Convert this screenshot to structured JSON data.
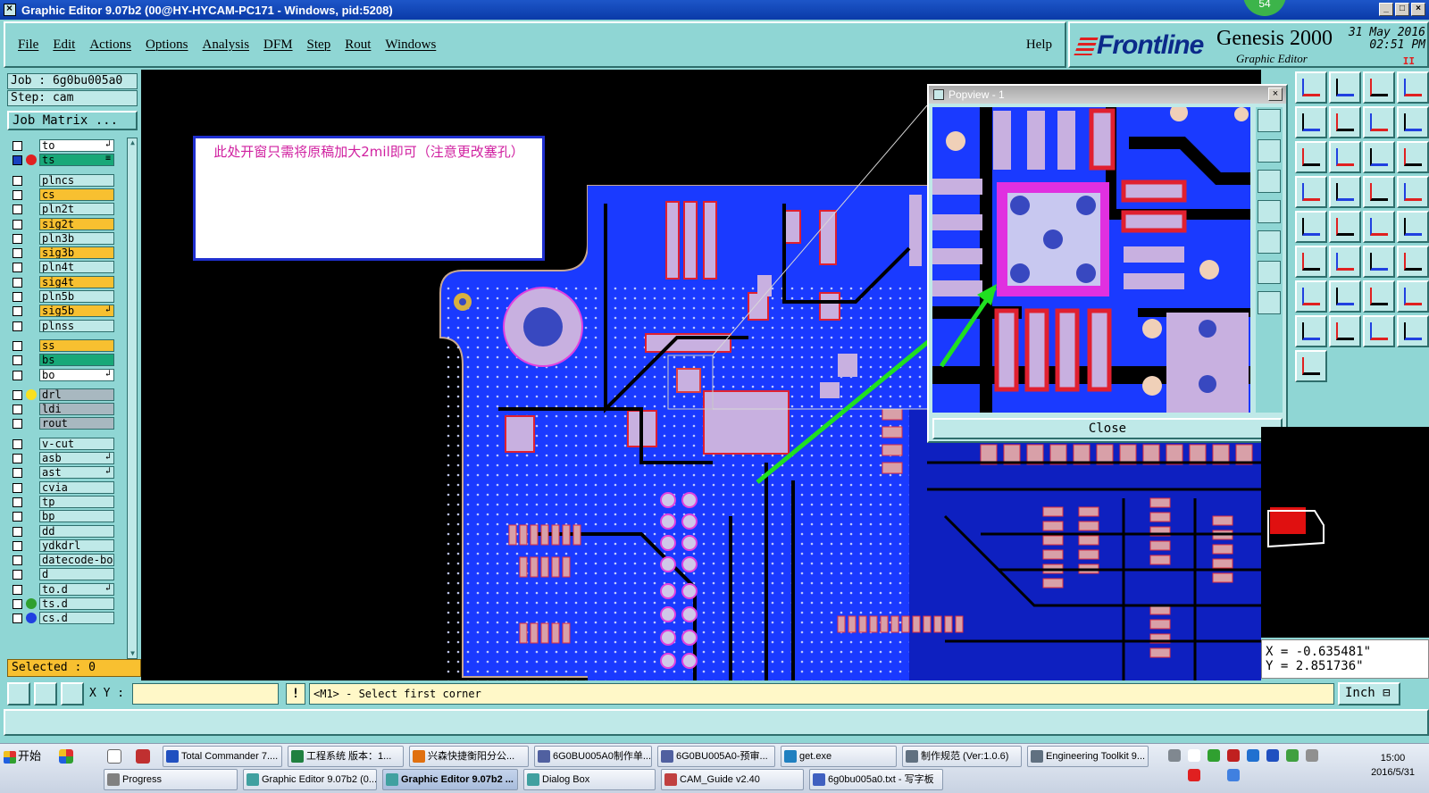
{
  "window": {
    "title": "Graphic Editor 9.07b2 (00@HY-HYCAM-PC171 - Windows, pid:5208)",
    "badge": "54",
    "controls": [
      "_",
      "□",
      "×"
    ]
  },
  "menu": {
    "items": [
      "File",
      "Edit",
      "Actions",
      "Options",
      "Analysis",
      "DFM",
      "Step",
      "Rout",
      "Windows"
    ],
    "help": "Help"
  },
  "brand": {
    "logo": "Frontline",
    "product": "Genesis 2000",
    "subtitle": "Graphic Editor",
    "date": "31 May 2016",
    "time": "02:51 PM",
    "pause": "II"
  },
  "job": {
    "job_line": "Job : 6g0bu005a0",
    "step_line": "Step: cam",
    "matrix_button": "Job Matrix ..."
  },
  "layers": [
    {
      "name": "to",
      "color": "#ffffff",
      "dot": "",
      "flag": "↲"
    },
    {
      "name": "ts",
      "color": "#18a878",
      "dot": "#e02020",
      "flag": "≡",
      "selected": true
    },
    {
      "name": "plncs",
      "color": "#bfe9e8",
      "dot": "",
      "flag": ""
    },
    {
      "name": "cs",
      "color": "#f8c030",
      "dot": "",
      "flag": ""
    },
    {
      "name": "pln2t",
      "color": "#bfe9e8",
      "dot": "",
      "flag": ""
    },
    {
      "name": "sig2t",
      "color": "#f8c030",
      "dot": "",
      "flag": ""
    },
    {
      "name": "pln3b",
      "color": "#bfe9e8",
      "dot": "",
      "flag": ""
    },
    {
      "name": "sig3b",
      "color": "#f8c030",
      "dot": "",
      "flag": ""
    },
    {
      "name": "pln4t",
      "color": "#bfe9e8",
      "dot": "",
      "flag": ""
    },
    {
      "name": "sig4t",
      "color": "#f8c030",
      "dot": "",
      "flag": ""
    },
    {
      "name": "pln5b",
      "color": "#bfe9e8",
      "dot": "",
      "flag": ""
    },
    {
      "name": "sig5b",
      "color": "#f8c030",
      "dot": "",
      "flag": "↲"
    },
    {
      "name": "plnss",
      "color": "#bfe9e8",
      "dot": "",
      "flag": ""
    },
    {
      "name": "ss",
      "color": "#f8c030",
      "dot": "",
      "flag": ""
    },
    {
      "name": "bs",
      "color": "#18a878",
      "dot": "",
      "flag": ""
    },
    {
      "name": "bo",
      "color": "#ffffff",
      "dot": "",
      "flag": "↲"
    },
    {
      "name": "drl",
      "color": "#a8b8c0",
      "dot": "#f8e020",
      "flag": ""
    },
    {
      "name": "ldi",
      "color": "#a8b8c0",
      "dot": "",
      "flag": ""
    },
    {
      "name": "rout",
      "color": "#a8b8c0",
      "dot": "",
      "flag": ""
    },
    {
      "name": "v-cut",
      "color": "#bfe9e8",
      "dot": "",
      "flag": ""
    },
    {
      "name": "asb",
      "color": "#bfe9e8",
      "dot": "",
      "flag": "↲"
    },
    {
      "name": "ast",
      "color": "#bfe9e8",
      "dot": "",
      "flag": "↲"
    },
    {
      "name": "cvia",
      "color": "#bfe9e8",
      "dot": "",
      "flag": ""
    },
    {
      "name": "tp",
      "color": "#bfe9e8",
      "dot": "",
      "flag": ""
    },
    {
      "name": "bp",
      "color": "#bfe9e8",
      "dot": "",
      "flag": ""
    },
    {
      "name": "dd",
      "color": "#bfe9e8",
      "dot": "",
      "flag": ""
    },
    {
      "name": "ydkdrl",
      "color": "#bfe9e8",
      "dot": "",
      "flag": ""
    },
    {
      "name": "datecode-bo",
      "color": "#bfe9e8",
      "dot": "",
      "flag": ""
    },
    {
      "name": "d",
      "color": "#bfe9e8",
      "dot": "",
      "flag": ""
    },
    {
      "name": "to.d",
      "color": "#bfe9e8",
      "dot": "",
      "flag": "↲"
    },
    {
      "name": "ts.d",
      "color": "#bfe9e8",
      "dot": "#30a030",
      "flag": ""
    },
    {
      "name": "cs.d",
      "color": "#bfe9e8",
      "dot": "#2040e0",
      "flag": ""
    }
  ],
  "selected_label": "Selected : 0",
  "annotation": {
    "text": "此处开窗只需将原稿加大2mil即可（注意更改塞孔）"
  },
  "popview": {
    "title": "Popview - 1",
    "close_label": "Close"
  },
  "coords": {
    "x_line": "X = -0.635481\"",
    "y_line": "Y = 2.851736\""
  },
  "cmd": {
    "xy_label": "X Y :",
    "xy_value": "",
    "warn": "!",
    "prompt": "<M1> - Select first corner",
    "units": "Inch ⊟"
  },
  "taskbar": {
    "start": "开始",
    "row1": [
      {
        "label": "Total Commander 7....",
        "color": "#2050c0"
      },
      {
        "label": "工程系统  版本：1...",
        "color": "#208040"
      },
      {
        "label": "兴森快捷衡阳分公...",
        "color": "#e07010"
      },
      {
        "label": "6G0BU005A0制作单...",
        "color": "#5060a0"
      },
      {
        "label": "6G0BU005A0-预审...",
        "color": "#5060a0"
      },
      {
        "label": "get.exe",
        "color": "#2080c0"
      },
      {
        "label": "制作规范 (Ver:1.0.6)",
        "color": "#607080"
      },
      {
        "label": "Engineering Toolkit 9...",
        "color": "#607080"
      }
    ],
    "row2": [
      {
        "label": "Progress",
        "color": "#808080"
      },
      {
        "label": "Graphic Editor 9.07b2 (0...",
        "color": "#40a0a0"
      },
      {
        "label": "Graphic Editor 9.07b2 ...",
        "color": "#40a0a0",
        "active": true
      },
      {
        "label": "Dialog Box",
        "color": "#40a0a0"
      },
      {
        "label": "CAM_Guide v2.40",
        "color": "#c04040"
      },
      {
        "label": "6g0bu005a0.txt - 写字板",
        "color": "#4060c0"
      }
    ],
    "clock_time": "15:00",
    "clock_date": "2016/5/31"
  }
}
